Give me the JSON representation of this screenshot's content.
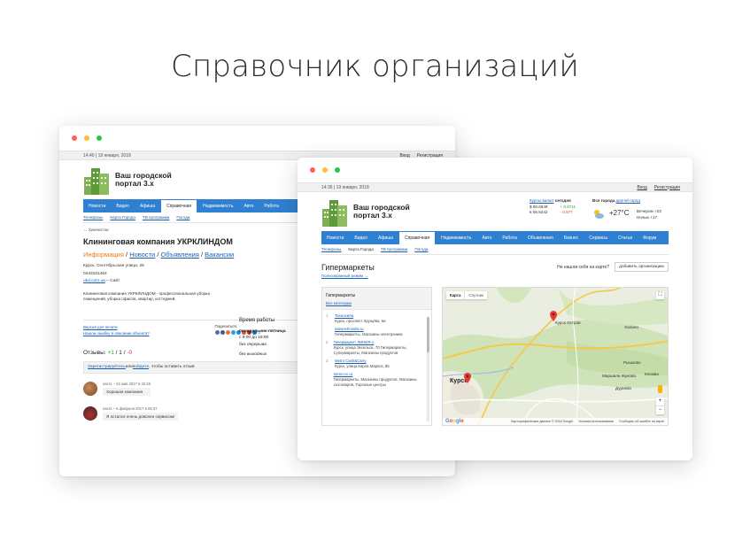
{
  "hero": {
    "title": "Справочник организаций"
  },
  "back": {
    "datetime": "14:40 | 19 января, 2018",
    "top_links": [
      "Вход",
      "Регистрация"
    ],
    "logo": "Ваш городской портал 3.x",
    "nav": [
      "Новости",
      "Видео",
      "Афиша",
      "Справочная",
      "Недвижимость",
      "Авто",
      "Работа"
    ],
    "subnav": [
      "Телефоны",
      "Карта Города",
      "ТВ программа",
      "Погода"
    ],
    "breadcrumb": "← Химчистки",
    "company": "Клининговая компания УКРКЛИНДОМ",
    "tabs": [
      "Информация",
      "Новости",
      "Объявления",
      "Вакансии"
    ],
    "address": "Курск, Сентябрьская улица, 26",
    "phone": "0443161464",
    "site_link": "ukd.com.ua",
    "site_suffix": " – Сайт",
    "description": "Клининговая компания УКРКЛИНДОМ - профессиональная уборка помещений, уборка офисов, квартир, коттеджей.",
    "hours": {
      "title": "Время работы",
      "days": "понедельник-пятница",
      "time": "с 9:00 до 19:00",
      "break": "без перерыва",
      "weekend": "без выходных"
    },
    "print_link": "Версия для печати",
    "error_link": "Нашли ошибку в описании объекта?",
    "share_label": "Поделиться:",
    "share_count": "0",
    "reviews": {
      "label": "Отзывы:",
      "plus": "+1",
      "sep1": " / ",
      "neutral": "1",
      "sep2": " / ",
      "minus": "-0"
    },
    "login": {
      "register": "Зарегистрируйтесь",
      "or": " или ",
      "login": "войдите",
      "tail": ", чтобы оставить отзыв"
    },
    "comments": [
      {
        "meta": "user1 – 24 мая 2017 в 22:46",
        "text": "Хорошая компания"
      },
      {
        "meta": "user2 – 5 февраля 2017 в 05:37",
        "text": "Я остался очень доволен сервисом!"
      }
    ]
  },
  "front": {
    "datetime": "14:36 | 19 января, 2018",
    "top_links": [
      "Вход",
      "Регистрация"
    ],
    "logo": "Ваш городской портал 3.x",
    "rates": {
      "title": "Курсы валют",
      "title_suffix": " сегодня",
      "usd": "$ 60.6649",
      "usd_change": "+ 0.6711",
      "eur": "€ 65.5242",
      "eur_change": "- 0.577"
    },
    "weather": {
      "title": "Все города",
      "title_suffix": " другой город",
      "temp": "+27°C",
      "evening": "Вечером",
      "evening_temp": "+23",
      "night": "Ночью",
      "night_temp": "+17"
    },
    "nav": [
      "Новости",
      "Видео",
      "Афиша",
      "Справочная",
      "Недвижимость",
      "Авто",
      "Работа",
      "Объявления",
      "Бизнес",
      "Сервисы",
      "Статьи",
      "Форум"
    ],
    "subnav": [
      "Телефоны",
      "Карта Города",
      "ТВ программа",
      "Погода"
    ],
    "heading": "Гипермаркеты",
    "not_found": "Не нашли себя на карте?",
    "add_button": "добавить организацию",
    "full_mode": "Полноэкранный режим →",
    "list_title": "Гипермаркеты",
    "list_sub": "Все категории",
    "items": [
      {
        "n": "1",
        "name": "Техносила",
        "desc": "Курск, проспект Хрущёва, 5а"
      },
      {
        "n": "",
        "name": "www.tehnosila.ru",
        "desc": "Гипермаркеты, Магазины электроники"
      },
      {
        "n": "2",
        "name": "Гипермаркет ЛИНИЯ-1",
        "desc": "Курск, улица Энгельса, 70 Гипермаркеты, Супермаркеты, Магазины продуктов"
      },
      {
        "n": "3",
        "name": "Metro Cash&Carry",
        "desc": "Курск, улица Карла Маркса, 85"
      },
      {
        "n": "",
        "name": "metro-cc.ru",
        "desc": "Гипермаркеты, Магазины продуктов, Магазины хозтоваров, Торговые центры"
      }
    ],
    "map": {
      "tab_map": "Карта",
      "tab_sat": "Спутник",
      "city": "Курск",
      "labels": [
        "Курск Остров",
        "Халино",
        "Клюква",
        "Маршала Жукова",
        "Дурнево",
        "Рышково"
      ],
      "footer": [
        "Картографические данные © 2018 Google",
        "Условия использования",
        "Сообщить об ошибке на карте"
      ],
      "zoom_in": "+",
      "zoom_out": "−"
    }
  },
  "colors": {
    "nav": "#2f80d0",
    "link": "#1a5fb4",
    "accent": "#f07a1a"
  }
}
